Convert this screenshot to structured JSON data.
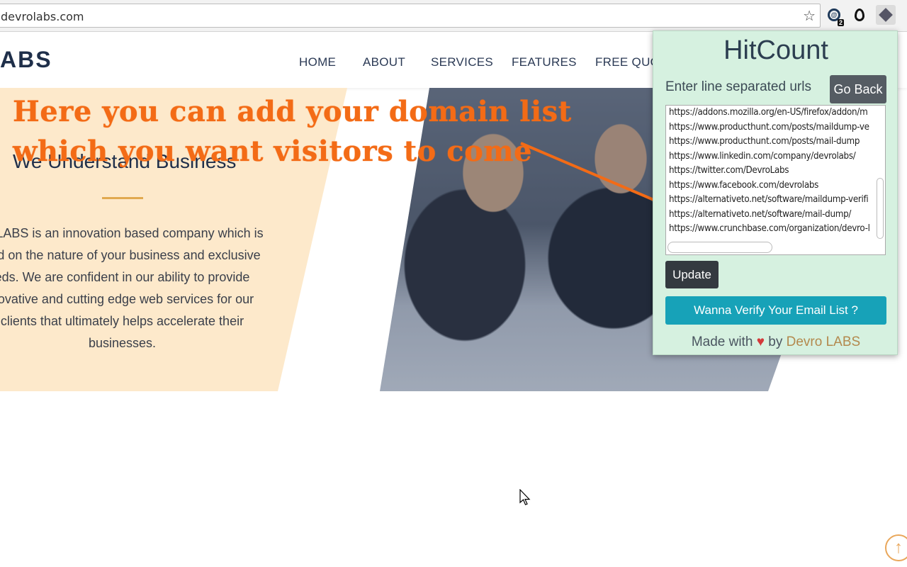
{
  "browser": {
    "url": "devrolabs.com",
    "star_icon": "star-icon",
    "extensions": [
      {
        "name": "email-extension-icon",
        "badge": "2"
      },
      {
        "name": "pin-extension-icon"
      },
      {
        "name": "hitcount-extension-icon"
      }
    ]
  },
  "site": {
    "logo": "ABS",
    "nav": [
      "HOME",
      "ABOUT",
      "SERVICES",
      "FEATURES",
      "FREE QUOT"
    ]
  },
  "hero": {
    "title": "We Understand Business",
    "text": "ro LABS is an innovation based company which is sed on the nature of your business and exclusive eds. We are confident in our ability to provide novative and cutting edge web services for our clients that ultimately helps accelerate their businesses."
  },
  "annotation": {
    "line1": "Here you can add your domain list",
    "line2": "which you want visitors to come",
    "color": "#f36b16"
  },
  "popup": {
    "title": "HitCount",
    "label": "Enter line separated urls",
    "go_back": "Go Back",
    "urls": [
      "https://addons.mozilla.org/en-US/firefox/addon/m",
      "https://www.producthunt.com/posts/maildump-ve",
      "https://www.producthunt.com/posts/mail-dump",
      "https://www.linkedin.com/company/devrolabs/",
      "https://twitter.com/DevroLabs",
      "https://www.facebook.com/devrolabs",
      "https://alternativeto.net/software/maildump-verifi",
      "https://alternativeto.net/software/mail-dump/",
      "https://www.crunchbase.com/organization/devro-l"
    ],
    "update": "Update",
    "verify": "Wanna Verify Your Email List ?",
    "footer_made": "Made with",
    "footer_heart": "♥",
    "footer_by": "by",
    "footer_link": "Devro LABS",
    "bg_color": "#d6f1e0",
    "verify_color": "#17a2b8"
  },
  "scroll_top_icon": "↑"
}
